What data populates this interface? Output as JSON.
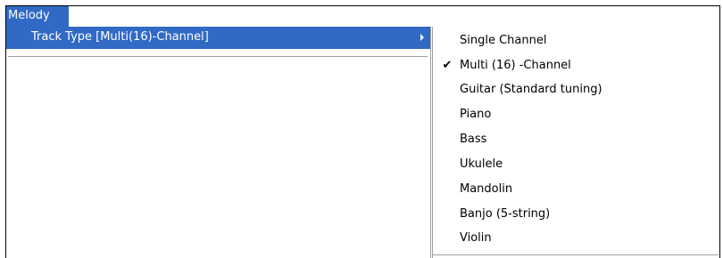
{
  "menubar": {
    "title": "Melody"
  },
  "menu": {
    "items": [
      {
        "label": "Track Type [Multi(16)-Channel]",
        "has_submenu": true,
        "highlighted": true
      }
    ]
  },
  "submenu": {
    "checkmark": "✔",
    "items": [
      {
        "label": "Single Channel",
        "checked": false
      },
      {
        "label": "Multi (16) -Channel",
        "checked": true
      },
      {
        "label": "Guitar (Standard tuning)",
        "checked": false
      },
      {
        "label": "Piano",
        "checked": false
      },
      {
        "label": "Bass",
        "checked": false
      },
      {
        "label": "Ukulele",
        "checked": false
      },
      {
        "label": "Mandolin",
        "checked": false
      },
      {
        "label": "Banjo (5-string)",
        "checked": false
      },
      {
        "label": "Violin",
        "checked": false
      }
    ]
  },
  "colors": {
    "highlight": "#316ac5",
    "highlight_text": "#ffffff",
    "menu_background": "#ffffff",
    "separator": "#a0a0a0"
  }
}
